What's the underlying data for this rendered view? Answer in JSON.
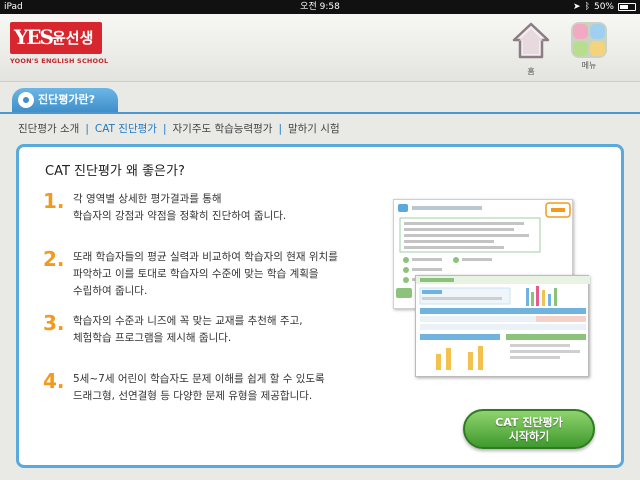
{
  "status_bar": {
    "device": "iPad",
    "time": "오전 9:58",
    "battery": "50%"
  },
  "header": {
    "logo_mark": "YES",
    "logo_name": "윤선생",
    "logo_sub": "YOON'S ENGLISH SCHOOL",
    "home_label": "홈",
    "menu_label": "메뉴"
  },
  "section_tab": "진단평가란?",
  "subnav": [
    {
      "label": "진단평가 소개"
    },
    {
      "label": "CAT 진단평가"
    },
    {
      "label": "자기주도 학습능력평가"
    },
    {
      "label": "말하기 시험"
    }
  ],
  "panel": {
    "title": "CAT 진단평가 왜 좋은가?",
    "points": [
      {
        "num": "1.",
        "lines": [
          "각 영역별 상세한 평가결과를 통해",
          "학습자의 강점과 약점을 정확히 진단하여 줍니다."
        ]
      },
      {
        "num": "2.",
        "lines": [
          "또래 학습자들의 평균 실력과 비교하여 학습자의 현재 위치를",
          "파악하고 이를 토대로 학습자의 수준에 맞는 학습 계획을",
          "수립하여 줍니다."
        ]
      },
      {
        "num": "3.",
        "lines": [
          "학습자의 수준과 니즈에 꼭 맞는 교재를 추천해 주고,",
          "체험학습 프로그램을 제시해 줍니다."
        ]
      },
      {
        "num": "4.",
        "lines": [
          "5세~7세 어린이 학습자도 문제 이해를 쉽게 할 수 있도록",
          "드래그형, 선연결형 등 다양한 문제 유형을 제공합니다."
        ]
      }
    ],
    "start_button": [
      "CAT 진단평가",
      "시작하기"
    ]
  },
  "colors": {
    "accent_blue": "#4b97cf",
    "number_orange": "#f39a1e",
    "logo_red": "#d8262e",
    "start_green": "#4fae37"
  }
}
